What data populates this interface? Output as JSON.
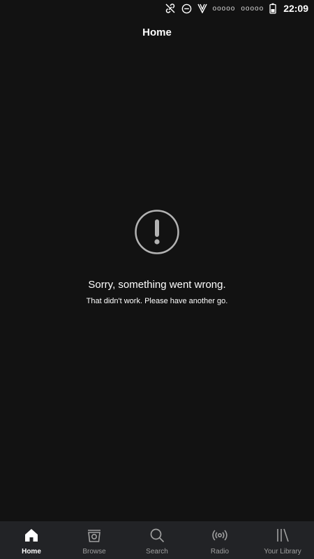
{
  "status_bar": {
    "dots_1": "ooooo",
    "dots_2": "ooooo",
    "time": "22:09",
    "icons": [
      "link-off-icon",
      "do-not-disturb-icon",
      "vpn-v-icon",
      "battery-icon"
    ]
  },
  "header": {
    "title": "Home"
  },
  "error": {
    "icon": "exclamation-circle-icon",
    "title": "Sorry, something went wrong.",
    "subtitle": "That didn't work. Please have another go."
  },
  "tabs": [
    {
      "label": "Home",
      "icon": "home-icon",
      "active": true
    },
    {
      "label": "Browse",
      "icon": "browse-icon",
      "active": false
    },
    {
      "label": "Search",
      "icon": "search-icon",
      "active": false
    },
    {
      "label": "Radio",
      "icon": "radio-icon",
      "active": false
    },
    {
      "label": "Your Library",
      "icon": "library-icon",
      "active": false
    }
  ],
  "colors": {
    "background": "#121212",
    "tab_bar": "#222326",
    "inactive": "#a0a0a0",
    "active": "#ffffff"
  }
}
